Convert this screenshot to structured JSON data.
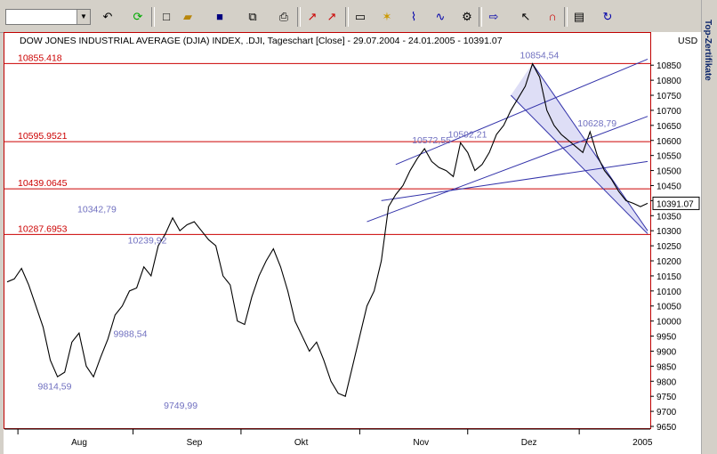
{
  "toolbar": {
    "symbol_value": "",
    "icons": [
      "undo-icon",
      "refresh-icon",
      "new-icon",
      "open-icon",
      "save-icon",
      "copy-icon",
      "print-icon",
      "chart-icon",
      "chart2-icon",
      "window-icon",
      "indicator-icon",
      "drawing-icon",
      "tools-icon",
      "settings-icon",
      "arrow-icon",
      "cursor-icon",
      "magnet-icon",
      "properties-icon",
      "reload-icon"
    ]
  },
  "side_panel": {
    "label": "Top-Zertifikate"
  },
  "chart_data": {
    "type": "line",
    "title": "DOW JONES INDUSTRIAL AVERAGE (DJIA) INDEX, .DJI, Tageschart [Close] - 29.07.2004 - 24.01.2005 - 10391.07",
    "currency": "USD",
    "ylim": [
      9650,
      10895
    ],
    "yticks": [
      10850,
      10800,
      10750,
      10700,
      10650,
      10600,
      10550,
      10500,
      10450,
      10400,
      10350,
      10300,
      10250,
      10200,
      10150,
      10100,
      10050,
      10000,
      9950,
      9900,
      9850,
      9800,
      9750,
      9700,
      9650
    ],
    "ytick_labels": [
      "10850",
      "10800",
      "10750",
      "10700",
      "10650",
      "10600",
      "10550",
      "10500",
      "10450",
      "10400",
      "10350",
      "10300",
      "10250",
      "10200",
      "10150",
      "10100",
      "10050",
      "10000",
      "9950",
      "9900",
      "9850",
      "9800",
      "9750",
      "9700",
      "9650"
    ],
    "x_ticks": [
      {
        "label": "Aug",
        "day": 3
      },
      {
        "label": "Sep",
        "day": 35
      },
      {
        "label": "Okt",
        "day": 65
      },
      {
        "label": "Nov",
        "day": 98
      },
      {
        "label": "Dez",
        "day": 128
      },
      {
        "label": "2005",
        "day": 159
      }
    ],
    "x_range": [
      0,
      178
    ],
    "series": [
      {
        "x": [
          0,
          2,
          4,
          6,
          8,
          10,
          12,
          14,
          16,
          18,
          20,
          22,
          24,
          26,
          28,
          30,
          32,
          34,
          36,
          38,
          40,
          42,
          44,
          46,
          48,
          50,
          52,
          54,
          56,
          58,
          60,
          62,
          64,
          66,
          68,
          70,
          72,
          74,
          76,
          78,
          80,
          82,
          84,
          86,
          88,
          90,
          92,
          94,
          96,
          98,
          100,
          102,
          104,
          106,
          108,
          110,
          112,
          114,
          116,
          118,
          120,
          122,
          124,
          126,
          128,
          130,
          132,
          134,
          136,
          138,
          140,
          142,
          144,
          146,
          148,
          150,
          152,
          154,
          156,
          158,
          160,
          162,
          164,
          166,
          168,
          170,
          172,
          174,
          176,
          178
        ],
        "y": [
          10130,
          10140,
          10175,
          10120,
          10050,
          9980,
          9870,
          9815,
          9830,
          9930,
          9960,
          9850,
          9814.59,
          9880,
          9940,
          10020,
          10050,
          10100,
          10110,
          10180,
          10150,
          10250,
          10290,
          10342.79,
          10300,
          10320,
          10330,
          10300,
          10270,
          10250,
          10150,
          10120,
          10000,
          9988.54,
          10080,
          10150,
          10200,
          10239.92,
          10180,
          10100,
          10000,
          9950,
          9900,
          9930,
          9870,
          9800,
          9760,
          9749.99,
          9850,
          9950,
          10050,
          10100,
          10200,
          10380,
          10420,
          10450,
          10500,
          10540,
          10572.55,
          10530,
          10510,
          10500,
          10480,
          10592.21,
          10560,
          10500,
          10520,
          10560,
          10620,
          10650,
          10700,
          10740,
          10780,
          10854.54,
          10810,
          10700,
          10650,
          10620,
          10600,
          10580,
          10560,
          10628.79,
          10550,
          10500,
          10470,
          10430,
          10400,
          10391.07,
          10380,
          10391.07
        ]
      }
    ],
    "hlines": [
      {
        "value": 10855.418,
        "label": "10855.418"
      },
      {
        "value": 10595.9521,
        "label": "10595.9521"
      },
      {
        "value": 10439.0645,
        "label": "10439.0645"
      },
      {
        "value": 10287.6953,
        "label": "10287.6953"
      }
    ],
    "annotations": [
      {
        "x": 12,
        "y": 9814.59,
        "label": "9814,59",
        "pos": "below"
      },
      {
        "x": 23,
        "y": 10342.79,
        "label": "10342,79",
        "pos": "above"
      },
      {
        "x": 33,
        "y": 9988.54,
        "label": "9988,54",
        "pos": "below"
      },
      {
        "x": 37,
        "y": 10239.92,
        "label": "10239,92",
        "pos": "above"
      },
      {
        "x": 47,
        "y": 9749.99,
        "label": "9749,99",
        "pos": "below"
      },
      {
        "x": 116,
        "y": 10572.55,
        "label": "10572,55",
        "pos": "above"
      },
      {
        "x": 126,
        "y": 10592.21,
        "label": "10592,21",
        "pos": "above"
      },
      {
        "x": 146,
        "y": 10854.54,
        "label": "10854,54",
        "pos": "above"
      },
      {
        "x": 162,
        "y": 10628.79,
        "label": "10628,79",
        "pos": "above"
      }
    ],
    "trendlines": [
      {
        "x1": 108,
        "y1": 10520,
        "x2": 178,
        "y2": 10870
      },
      {
        "x1": 100,
        "y1": 10330,
        "x2": 178,
        "y2": 10680
      },
      {
        "x1": 104,
        "y1": 10400,
        "x2": 178,
        "y2": 10530
      },
      {
        "x1": 146,
        "y1": 10855,
        "x2": 178,
        "y2": 10300
      },
      {
        "x1": 140,
        "y1": 10750,
        "x2": 178,
        "y2": 10290
      }
    ],
    "last_value_label": "10391.07",
    "grid": false,
    "colors": {
      "line": "#000000",
      "hline": "#cc0000",
      "trend": "#3333aa",
      "label": "#7070c0",
      "frame": "#c00000",
      "channel": "#c8c8f0"
    }
  }
}
